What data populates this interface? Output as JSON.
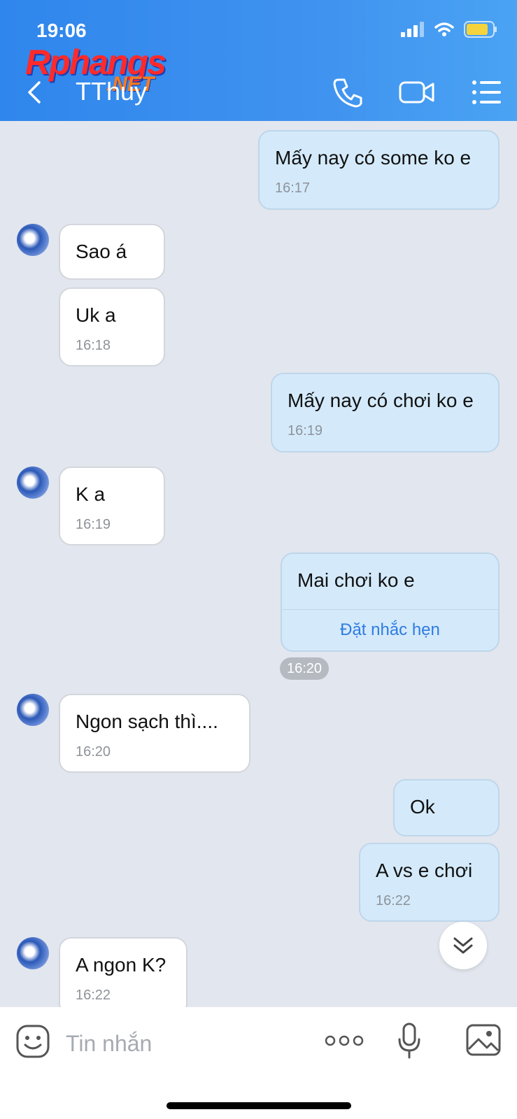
{
  "status": {
    "time": "19:06"
  },
  "watermark": {
    "logo": "Rphangs",
    "suffix": ".NET"
  },
  "header": {
    "title": "TThuy"
  },
  "messages": [
    {
      "dir": "out",
      "text": "Mấy nay có some ko e",
      "time": "16:17"
    },
    {
      "dir": "in",
      "text": "Sao á"
    },
    {
      "dir": "in",
      "text": "Uk a",
      "time": "16:18"
    },
    {
      "dir": "out",
      "text": "Mấy nay có chơi ko e",
      "time": "16:19"
    },
    {
      "dir": "in",
      "text": "K a",
      "time": "16:19"
    },
    {
      "dir": "out",
      "text": "Mai chơi ko e",
      "action": "Đặt nhắc hẹn",
      "time": "16:20"
    },
    {
      "dir": "in",
      "text": "Ngon sạch thì....",
      "time": "16:20"
    },
    {
      "dir": "out",
      "text": "Ok"
    },
    {
      "dir": "out",
      "text": "A vs e chơi",
      "time": "16:22"
    },
    {
      "dir": "in",
      "text": "A ngon K?",
      "time": "16:22"
    }
  ],
  "input": {
    "placeholder": "Tin nhắn"
  },
  "colors": {
    "header": "#3b8ef0",
    "outgoing_bubble": "#d4eafb",
    "incoming_bubble": "#ffffff",
    "chat_background": "#e2e6ee",
    "link": "#2f7be2"
  },
  "icons": [
    "back-chevron-icon",
    "phone-icon",
    "video-camera-icon",
    "menu-list-icon",
    "sticker-icon",
    "more-dots-icon",
    "microphone-icon",
    "image-icon",
    "chevron-double-down-icon"
  ]
}
